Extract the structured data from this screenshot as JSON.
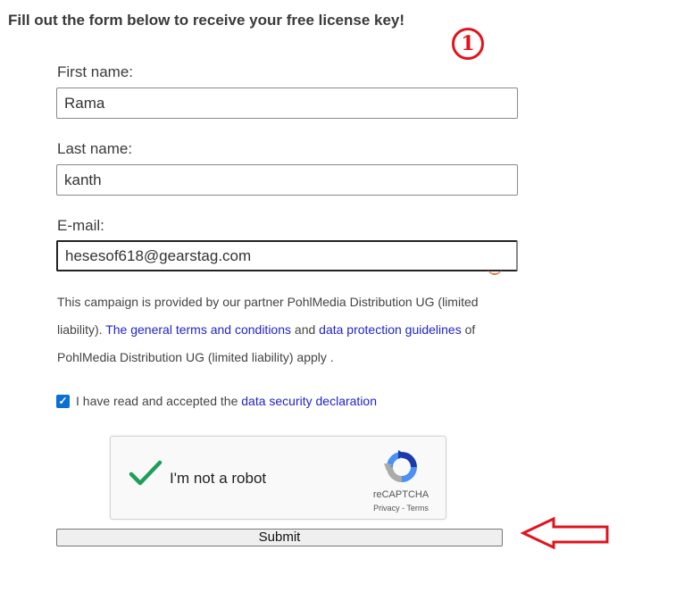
{
  "heading": "Fill out the form below to receive your free license key!",
  "annotation": {
    "step_marker": "1",
    "color": "#e0141e"
  },
  "form": {
    "first_name": {
      "label": "First name:",
      "value": "Rama"
    },
    "last_name": {
      "label": "Last name:",
      "value": "kanth"
    },
    "email": {
      "label": "E-mail:",
      "value": "hesesof618@gearstag.com"
    }
  },
  "notice": {
    "part1": "This campaign is provided by our partner PohlMedia Distribution UG (limited liability).",
    "terms_link": "The general terms and conditions",
    "and": "and",
    "privacy_link": "data protection guidelines",
    "part2": "of PohlMedia Distribution UG (limited liability) apply ."
  },
  "consent": {
    "checked": true,
    "text": "I have read and accepted the",
    "link": "data security declaration"
  },
  "recaptcha": {
    "label": "I'm not a robot",
    "brand": "reCAPTCHA",
    "privacy": "Privacy",
    "separator": " - ",
    "terms": "Terms",
    "check_color": "#1e9e5a"
  },
  "submit_label": "Submit",
  "colors": {
    "link": "#2323c8",
    "checkbox": "#0b6fd6",
    "annotation": "#e0141e"
  }
}
